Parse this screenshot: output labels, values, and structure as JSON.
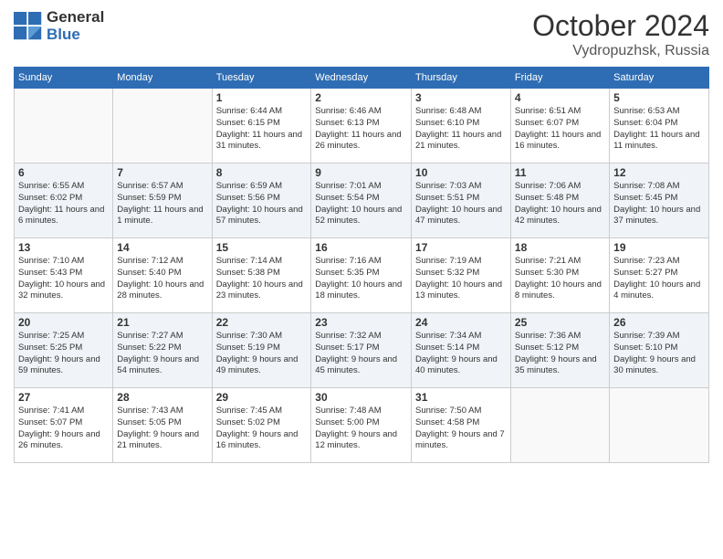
{
  "header": {
    "logo_line1": "General",
    "logo_line2": "Blue",
    "month": "October 2024",
    "location": "Vydropuzhsk, Russia"
  },
  "weekdays": [
    "Sunday",
    "Monday",
    "Tuesday",
    "Wednesday",
    "Thursday",
    "Friday",
    "Saturday"
  ],
  "weeks": [
    [
      {
        "day": "",
        "sunrise": "",
        "sunset": "",
        "daylight": ""
      },
      {
        "day": "",
        "sunrise": "",
        "sunset": "",
        "daylight": ""
      },
      {
        "day": "1",
        "sunrise": "Sunrise: 6:44 AM",
        "sunset": "Sunset: 6:15 PM",
        "daylight": "Daylight: 11 hours and 31 minutes."
      },
      {
        "day": "2",
        "sunrise": "Sunrise: 6:46 AM",
        "sunset": "Sunset: 6:13 PM",
        "daylight": "Daylight: 11 hours and 26 minutes."
      },
      {
        "day": "3",
        "sunrise": "Sunrise: 6:48 AM",
        "sunset": "Sunset: 6:10 PM",
        "daylight": "Daylight: 11 hours and 21 minutes."
      },
      {
        "day": "4",
        "sunrise": "Sunrise: 6:51 AM",
        "sunset": "Sunset: 6:07 PM",
        "daylight": "Daylight: 11 hours and 16 minutes."
      },
      {
        "day": "5",
        "sunrise": "Sunrise: 6:53 AM",
        "sunset": "Sunset: 6:04 PM",
        "daylight": "Daylight: 11 hours and 11 minutes."
      }
    ],
    [
      {
        "day": "6",
        "sunrise": "Sunrise: 6:55 AM",
        "sunset": "Sunset: 6:02 PM",
        "daylight": "Daylight: 11 hours and 6 minutes."
      },
      {
        "day": "7",
        "sunrise": "Sunrise: 6:57 AM",
        "sunset": "Sunset: 5:59 PM",
        "daylight": "Daylight: 11 hours and 1 minute."
      },
      {
        "day": "8",
        "sunrise": "Sunrise: 6:59 AM",
        "sunset": "Sunset: 5:56 PM",
        "daylight": "Daylight: 10 hours and 57 minutes."
      },
      {
        "day": "9",
        "sunrise": "Sunrise: 7:01 AM",
        "sunset": "Sunset: 5:54 PM",
        "daylight": "Daylight: 10 hours and 52 minutes."
      },
      {
        "day": "10",
        "sunrise": "Sunrise: 7:03 AM",
        "sunset": "Sunset: 5:51 PM",
        "daylight": "Daylight: 10 hours and 47 minutes."
      },
      {
        "day": "11",
        "sunrise": "Sunrise: 7:06 AM",
        "sunset": "Sunset: 5:48 PM",
        "daylight": "Daylight: 10 hours and 42 minutes."
      },
      {
        "day": "12",
        "sunrise": "Sunrise: 7:08 AM",
        "sunset": "Sunset: 5:45 PM",
        "daylight": "Daylight: 10 hours and 37 minutes."
      }
    ],
    [
      {
        "day": "13",
        "sunrise": "Sunrise: 7:10 AM",
        "sunset": "Sunset: 5:43 PM",
        "daylight": "Daylight: 10 hours and 32 minutes."
      },
      {
        "day": "14",
        "sunrise": "Sunrise: 7:12 AM",
        "sunset": "Sunset: 5:40 PM",
        "daylight": "Daylight: 10 hours and 28 minutes."
      },
      {
        "day": "15",
        "sunrise": "Sunrise: 7:14 AM",
        "sunset": "Sunset: 5:38 PM",
        "daylight": "Daylight: 10 hours and 23 minutes."
      },
      {
        "day": "16",
        "sunrise": "Sunrise: 7:16 AM",
        "sunset": "Sunset: 5:35 PM",
        "daylight": "Daylight: 10 hours and 18 minutes."
      },
      {
        "day": "17",
        "sunrise": "Sunrise: 7:19 AM",
        "sunset": "Sunset: 5:32 PM",
        "daylight": "Daylight: 10 hours and 13 minutes."
      },
      {
        "day": "18",
        "sunrise": "Sunrise: 7:21 AM",
        "sunset": "Sunset: 5:30 PM",
        "daylight": "Daylight: 10 hours and 8 minutes."
      },
      {
        "day": "19",
        "sunrise": "Sunrise: 7:23 AM",
        "sunset": "Sunset: 5:27 PM",
        "daylight": "Daylight: 10 hours and 4 minutes."
      }
    ],
    [
      {
        "day": "20",
        "sunrise": "Sunrise: 7:25 AM",
        "sunset": "Sunset: 5:25 PM",
        "daylight": "Daylight: 9 hours and 59 minutes."
      },
      {
        "day": "21",
        "sunrise": "Sunrise: 7:27 AM",
        "sunset": "Sunset: 5:22 PM",
        "daylight": "Daylight: 9 hours and 54 minutes."
      },
      {
        "day": "22",
        "sunrise": "Sunrise: 7:30 AM",
        "sunset": "Sunset: 5:19 PM",
        "daylight": "Daylight: 9 hours and 49 minutes."
      },
      {
        "day": "23",
        "sunrise": "Sunrise: 7:32 AM",
        "sunset": "Sunset: 5:17 PM",
        "daylight": "Daylight: 9 hours and 45 minutes."
      },
      {
        "day": "24",
        "sunrise": "Sunrise: 7:34 AM",
        "sunset": "Sunset: 5:14 PM",
        "daylight": "Daylight: 9 hours and 40 minutes."
      },
      {
        "day": "25",
        "sunrise": "Sunrise: 7:36 AM",
        "sunset": "Sunset: 5:12 PM",
        "daylight": "Daylight: 9 hours and 35 minutes."
      },
      {
        "day": "26",
        "sunrise": "Sunrise: 7:39 AM",
        "sunset": "Sunset: 5:10 PM",
        "daylight": "Daylight: 9 hours and 30 minutes."
      }
    ],
    [
      {
        "day": "27",
        "sunrise": "Sunrise: 7:41 AM",
        "sunset": "Sunset: 5:07 PM",
        "daylight": "Daylight: 9 hours and 26 minutes."
      },
      {
        "day": "28",
        "sunrise": "Sunrise: 7:43 AM",
        "sunset": "Sunset: 5:05 PM",
        "daylight": "Daylight: 9 hours and 21 minutes."
      },
      {
        "day": "29",
        "sunrise": "Sunrise: 7:45 AM",
        "sunset": "Sunset: 5:02 PM",
        "daylight": "Daylight: 9 hours and 16 minutes."
      },
      {
        "day": "30",
        "sunrise": "Sunrise: 7:48 AM",
        "sunset": "Sunset: 5:00 PM",
        "daylight": "Daylight: 9 hours and 12 minutes."
      },
      {
        "day": "31",
        "sunrise": "Sunrise: 7:50 AM",
        "sunset": "Sunset: 4:58 PM",
        "daylight": "Daylight: 9 hours and 7 minutes."
      },
      {
        "day": "",
        "sunrise": "",
        "sunset": "",
        "daylight": ""
      },
      {
        "day": "",
        "sunrise": "",
        "sunset": "",
        "daylight": ""
      }
    ]
  ]
}
